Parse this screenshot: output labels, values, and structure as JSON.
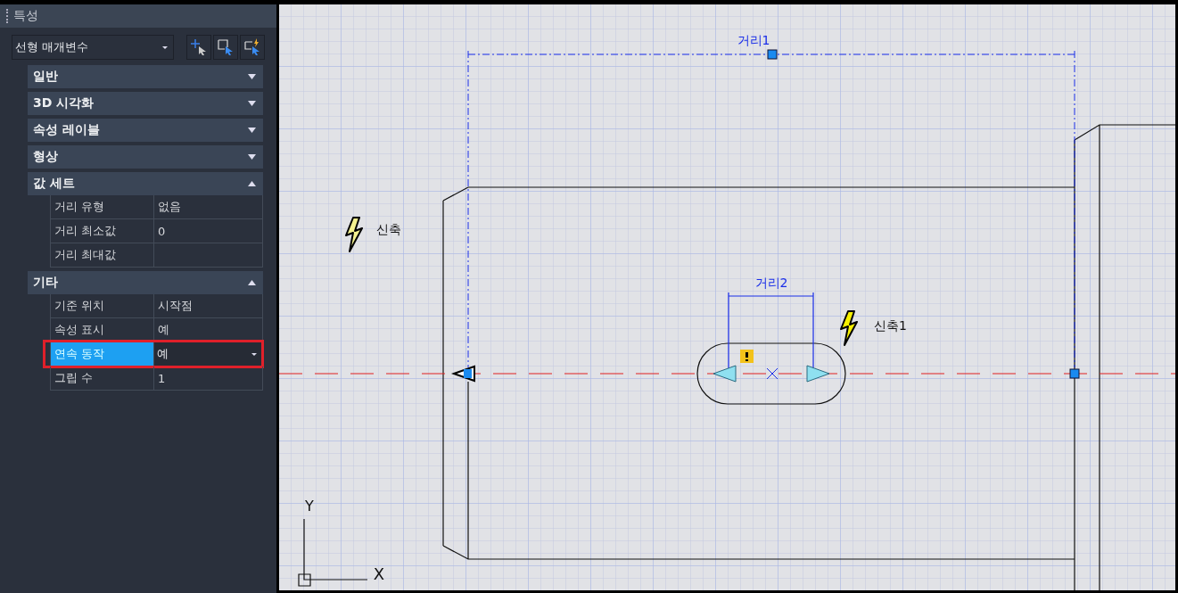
{
  "panel": {
    "title": "특성",
    "selector": {
      "value": "선형 매개변수"
    }
  },
  "sections": [
    {
      "title": "일반",
      "expanded": false
    },
    {
      "title": "3D 시각화",
      "expanded": false
    },
    {
      "title": "속성 레이블",
      "expanded": false
    },
    {
      "title": "형상",
      "expanded": false
    },
    {
      "title": "값 세트",
      "expanded": true,
      "rows": [
        {
          "label": "거리 유형",
          "value": "없음",
          "selected": false
        },
        {
          "label": "거리 최소값",
          "value": "0",
          "selected": false
        },
        {
          "label": "거리 최대값",
          "selected": false
        }
      ]
    },
    {
      "title": "기타",
      "expanded": true,
      "rows": [
        {
          "label": "기준 위치",
          "value": "시작점",
          "selected": false
        },
        {
          "label": "속성 표시",
          "value": "예",
          "selected": false
        },
        {
          "label": "연속 동작",
          "value": "예",
          "selected": true
        },
        {
          "label": "그립 수",
          "value": "1",
          "selected": false
        }
      ]
    }
  ],
  "canvas": {
    "labels": [
      {
        "kind": "dimension",
        "text": "거리1"
      },
      {
        "kind": "action",
        "text": "신축"
      },
      {
        "kind": "dimension",
        "text": "거리2"
      },
      {
        "kind": "action",
        "text": "신축1"
      }
    ],
    "ucs": {
      "y_label": "Y",
      "x_label": "X"
    }
  }
}
